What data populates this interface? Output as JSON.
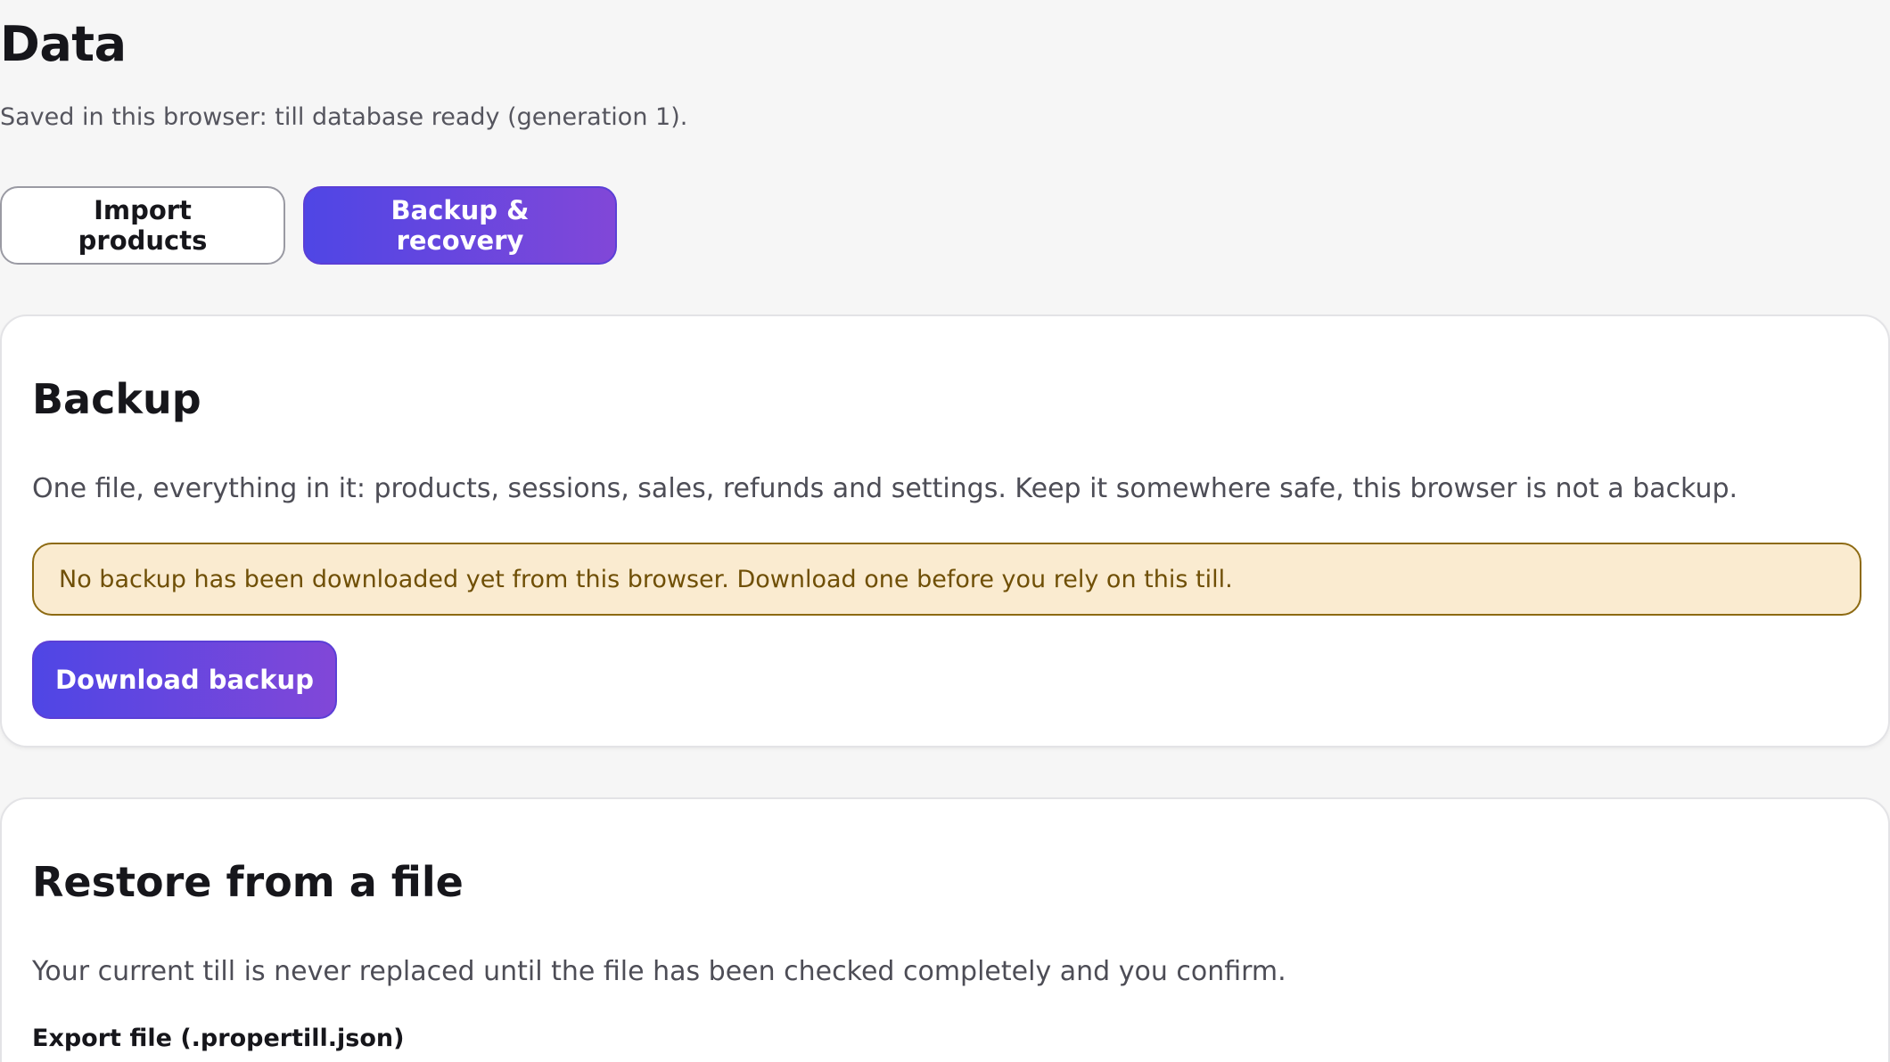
{
  "page": {
    "title": "Data",
    "subtitle": "Saved in this browser: till database ready (generation 1)."
  },
  "tabs": [
    {
      "label": "Import products",
      "active": false
    },
    {
      "label": "Backup & recovery",
      "active": true
    }
  ],
  "backup": {
    "heading": "Backup",
    "description": "One file, everything in it: products, sessions, sales, refunds and settings. Keep it somewhere safe, this browser is not a backup.",
    "notice": "No backup has been downloaded yet from this browser. Download one before you rely on this till.",
    "download_label": "Download backup"
  },
  "restore": {
    "heading": "Restore from a file",
    "description": "Your current till is never replaced until the file has been checked completely and you confirm.",
    "file_label": "Export file (.propertill.json)"
  },
  "colors": {
    "accent_start": "#4f46e5",
    "accent_end": "#8147d8",
    "notice_bg": "#faebd0",
    "notice_border": "#8d6a12",
    "notice_text": "#6f4f06",
    "page_bg": "#f6f6f6"
  }
}
